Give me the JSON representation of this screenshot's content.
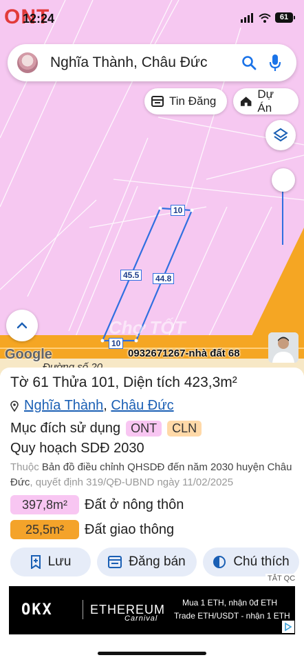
{
  "map": {
    "zone_code": "ONT",
    "watermark": "Chợ TỐT",
    "google_label": "Google",
    "road_label": "Đường số 20",
    "phone_banner": "0932671267-nhà đất 68",
    "dimensions": {
      "top": "10",
      "left": "45.5",
      "right": "44.8",
      "bottom": "10"
    },
    "colors": {
      "zone_ont": "#f6c8f1",
      "road": "#f5a623",
      "parcel_outline": "#2f6fe0"
    }
  },
  "status_bar": {
    "time": "12:24",
    "battery": "61"
  },
  "search": {
    "query": "Nghĩa Thành, Châu Đức"
  },
  "chips": {
    "news_label": "Tin Đăng",
    "projects_label": "Dự Án"
  },
  "parcel": {
    "title": "Tờ 61 Thửa 101, Diện tích 423,3m²",
    "ward": "Nghĩa Thành",
    "separator": ",",
    "district": "Châu Đức",
    "purpose_label": "Mục đích sử dụng",
    "purpose_tags": [
      "ONT",
      "CLN"
    ],
    "plan_title": "Quy hoạch SDĐ 2030",
    "plan_prefix": "Thuộc",
    "plan_desc": "Bản đồ điều chỉnh QHSDĐ đến năm 2030 huyện Châu Đức",
    "plan_decision": ", quyết định 319/QĐ-UBND ngày 11/02/2025",
    "areas": [
      {
        "value": "397,8m²",
        "label": "Đất ở nông thôn",
        "color": "#f8c6f2"
      },
      {
        "value": "25,5m²",
        "label": "Đất giao thông",
        "color": "#f4a32a"
      }
    ]
  },
  "actions": {
    "save": "Lưu",
    "post": "Đăng bán",
    "legend": "Chú thích"
  },
  "ad": {
    "close_label": "TẮT QC",
    "brand": "OKX",
    "campaign": "ETHEREUM",
    "campaign_sub": "Carnival",
    "line1": "Mua 1 ETH, nhận 0đ ETH",
    "line2": "Trade ETH/USDT - nhận 1 ETH"
  }
}
